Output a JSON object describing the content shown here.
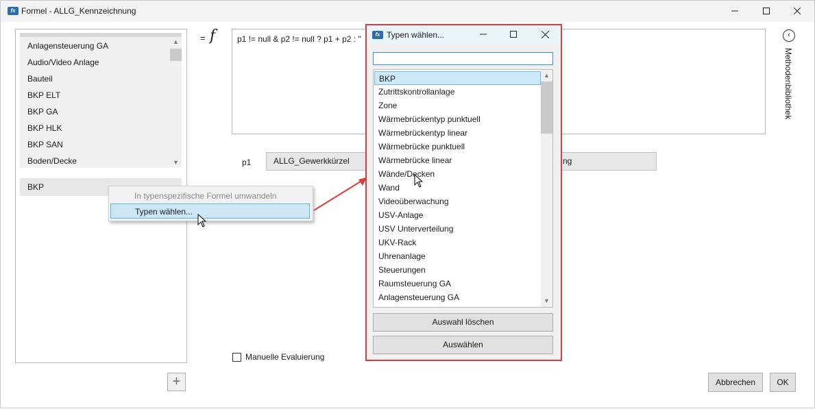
{
  "window": {
    "title": "Formel - ALLG_Kennzeichnung",
    "app_icon": "fx"
  },
  "left_list": {
    "items": [
      "Anlagensteuerung GA",
      "Audio/Video Anlage",
      "Bauteil",
      "BKP ELT",
      "BKP GA",
      "BKP HLK",
      "BKP SAN",
      "Boden/Decke"
    ],
    "selected_type": "BKP"
  },
  "context_menu": {
    "items": [
      {
        "label": "In typenspezifische Formel umwandeln",
        "enabled": false
      },
      {
        "label": "Typen wählen...",
        "enabled": true
      }
    ]
  },
  "formula": {
    "equals": "=",
    "symbol": "f",
    "text": "p1 != null & p2 != null ? p1 + p2 : \""
  },
  "params": {
    "p1_label": "p1",
    "p1_value": "ALLG_Gewerkkürzel",
    "p2_value_partial": "ng"
  },
  "manual_eval": {
    "label": "Manuelle Evaluierung",
    "checked": false
  },
  "buttons": {
    "add": "+",
    "cancel": "Abbrechen",
    "ok": "OK"
  },
  "sidebar": {
    "label": "Methodenbibliothek"
  },
  "popup": {
    "title": "Typen wählen...",
    "search_value": "",
    "items": [
      "BKP",
      "Zutrittskontrollanlage",
      "Zone",
      "Wärmebrückentyp punktuell",
      "Wärmebrückentyp linear",
      "Wärmebrücke punktuell",
      "Wärmebrücke linear",
      "Wände/Decken",
      "Wand",
      "Videoüberwachung",
      "USV-Anlage",
      "USV Unterverteilung",
      "UKV-Rack",
      "Uhrenanlage",
      "Steuerungen",
      "Raumsteuerung GA",
      "Anlagensteuerung GA"
    ],
    "selected_item": "BKP",
    "clear_label": "Auswahl löschen",
    "select_label": "Auswählen"
  },
  "colors": {
    "highlight_border": "#e03a3a",
    "selection": "#cde8f7"
  }
}
